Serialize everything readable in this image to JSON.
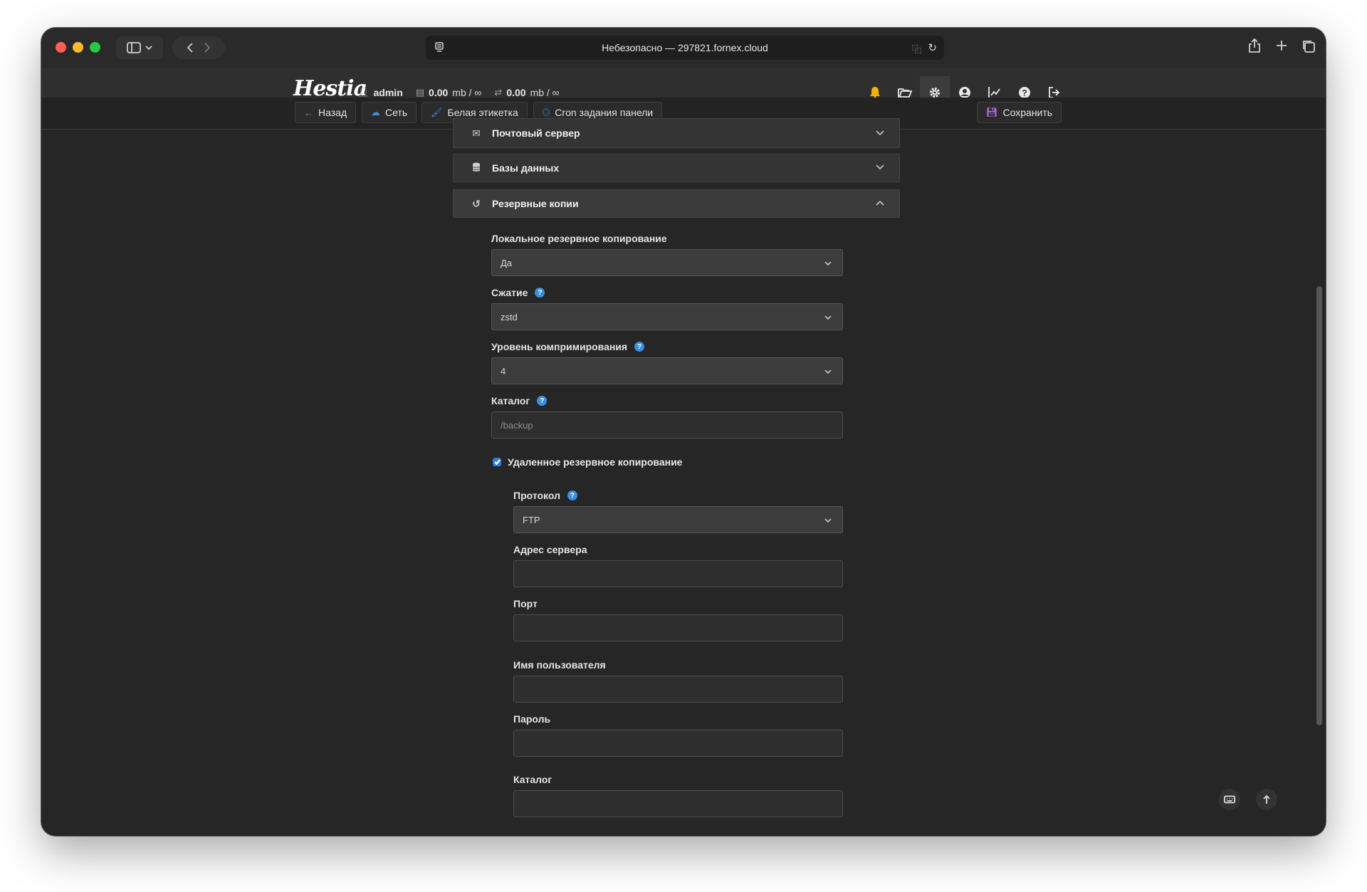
{
  "browser": {
    "address": "Небезопасно — 297821.fornex.cloud"
  },
  "topbar": {
    "logo": "Hestia",
    "user": "admin",
    "disk_value": "0.00",
    "disk_unit": "mb / ∞",
    "bandwidth_value": "0.00",
    "bandwidth_unit": "mb / ∞",
    "icons": [
      "bell-icon",
      "folder-icon",
      "gear-icon",
      "user-circle-icon",
      "chart-icon",
      "help-icon",
      "logout-icon"
    ]
  },
  "toolbar": {
    "back_label": "Назад",
    "network_label": "Сеть",
    "white_label": "Белая этикетка",
    "cron_label": "Cron задания панели",
    "save_label": "Сохранить"
  },
  "sections": {
    "mail_server": "Почтовый сервер",
    "databases": "Базы данных",
    "backups": "Резервные копии"
  },
  "backup_form": {
    "local_backup_label": "Локальное резервное копирование",
    "local_backup_value": "Да",
    "compression_label": "Сжатие",
    "compression_value": "zstd",
    "compression_level_label": "Уровень компримирования",
    "compression_level_value": "4",
    "directory_label": "Каталог",
    "directory_placeholder": "/backup",
    "remote_backup_label": "Удаленное резервное копирование",
    "remote_backup_checked": true,
    "protocol_label": "Протокол",
    "protocol_value": "FTP",
    "server_address_label": "Адрес сервера",
    "port_label": "Порт",
    "username_label": "Имя пользователя",
    "password_label": "Пароль",
    "remote_directory_label": "Каталог"
  },
  "colors": {
    "accent_blue": "#3a8fe0",
    "bell_yellow": "#f0b400",
    "background": "#262626"
  }
}
